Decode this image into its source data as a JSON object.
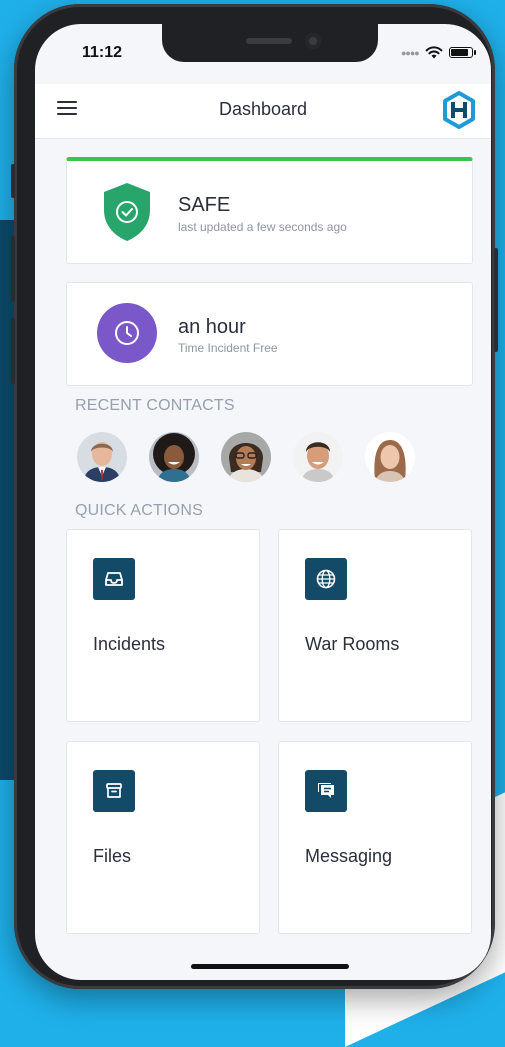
{
  "status_bar": {
    "time": "11:12"
  },
  "header": {
    "title": "Dashboard"
  },
  "status_card": {
    "status": "SAFE",
    "updated": "last updated a few seconds ago"
  },
  "incident_card": {
    "duration": "an hour",
    "caption": "Time Incident Free"
  },
  "recent_contacts": {
    "label": "RECENT CONTACTS"
  },
  "quick_actions": {
    "label": "QUICK ACTIONS",
    "items": [
      {
        "label": "Incidents",
        "icon": "inbox-icon"
      },
      {
        "label": "War Rooms",
        "icon": "globe-icon"
      },
      {
        "label": "Files",
        "icon": "archive-icon"
      },
      {
        "label": "Messaging",
        "icon": "chat-icon"
      }
    ]
  },
  "colors": {
    "accent_dark": "#124a68",
    "safe_green": "#3cc54a",
    "shield_green": "#27a56b",
    "clock_purple": "#7b58c9",
    "background_blue": "#1fb0ea"
  }
}
